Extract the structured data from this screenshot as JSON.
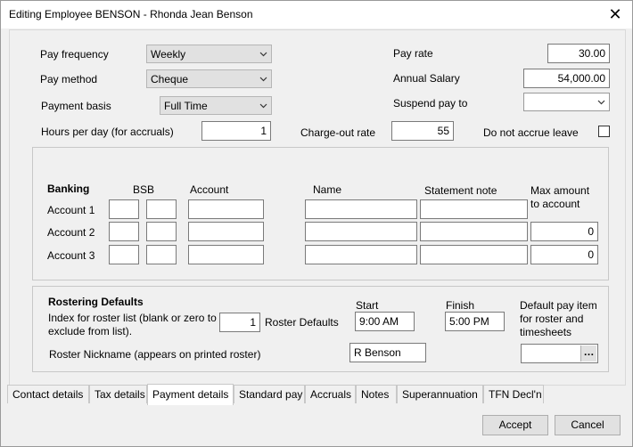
{
  "window": {
    "title": "Editing Employee BENSON - Rhonda Jean Benson",
    "close_glyph": "✕"
  },
  "pay": {
    "frequency_label": "Pay frequency",
    "frequency_value": "Weekly",
    "method_label": "Pay method",
    "method_value": "Cheque",
    "basis_label": "Payment basis",
    "basis_value": "Full Time",
    "hours_label": "Hours per day (for accruals)",
    "hours_value": "1",
    "rate_label": "Pay rate",
    "rate_value": "30.00",
    "salary_label": "Annual Salary",
    "salary_value": "54,000.00",
    "suspend_label": "Suspend pay to",
    "suspend_value": "",
    "charge_label": "Charge-out rate",
    "charge_value": "55",
    "accrue_label": "Do not accrue leave"
  },
  "banking": {
    "title": "Banking",
    "headers": {
      "bsb": "BSB",
      "account": "Account",
      "name": "Name",
      "note": "Statement note",
      "max": "Max amount to account"
    },
    "rows": [
      {
        "label": "Account 1",
        "bsb1": "",
        "bsb2": "",
        "account": "",
        "name": "",
        "note": "",
        "max": ""
      },
      {
        "label": "Account 2",
        "bsb1": "",
        "bsb2": "",
        "account": "",
        "name": "",
        "note": "",
        "max": "0"
      },
      {
        "label": "Account 3",
        "bsb1": "",
        "bsb2": "",
        "account": "",
        "name": "",
        "note": "",
        "max": "0"
      }
    ]
  },
  "roster": {
    "title": "Rostering Defaults",
    "index_label": "Index for roster list (blank or zero to exclude from list).",
    "index_value": "1",
    "defaults_label": "Roster Defaults",
    "start_label": "Start",
    "start_value": "9:00 AM",
    "finish_label": "Finish",
    "finish_value": "5:00 PM",
    "pay_item_label": "Default pay item for roster and timesheets",
    "pay_item_value": "",
    "nickname_label": "Roster Nickname (appears on printed roster)",
    "nickname_value": "R Benson",
    "ellipsis": "…"
  },
  "tabs": [
    "Contact details",
    "Tax details",
    "Payment details",
    "Standard pay",
    "Accruals",
    "Notes",
    "Superannuation",
    "TFN Decl'n"
  ],
  "active_tab": "Payment details",
  "buttons": {
    "accept": "Accept",
    "cancel": "Cancel"
  }
}
